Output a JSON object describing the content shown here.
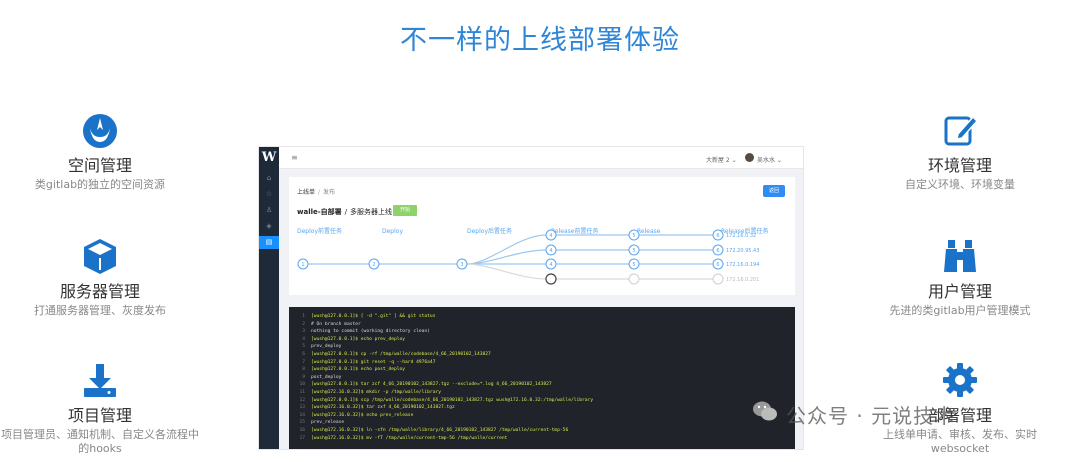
{
  "page": {
    "title": "不一样的上线部署体验"
  },
  "features_left": [
    {
      "title": "空间管理",
      "desc": "类gitlab的独立的空间资源",
      "icon": "rebel-alliance-icon"
    },
    {
      "title": "服务器管理",
      "desc": "打通服务器管理、灰度发布",
      "icon": "cube-icon"
    },
    {
      "title": "项目管理",
      "desc": "项目管理员、通知机制、自定义各流程中的hooks",
      "icon": "download-icon"
    }
  ],
  "features_right": [
    {
      "title": "环境管理",
      "desc": "自定义环境、环境变量",
      "icon": "edit-icon"
    },
    {
      "title": "用户管理",
      "desc": "先进的类gitlab用户管理模式",
      "icon": "binoculars-icon"
    },
    {
      "title": "部署管理",
      "desc": "上线单申请、审核、发布、实时websocket",
      "icon": "gear-icon"
    }
  ],
  "app": {
    "logo": "W",
    "menu_icon": "≡",
    "project_menu": "大新屋 2 ⌄",
    "user_name": "吴水水 ⌄",
    "sidebar": [
      "home-icon",
      "star-icon",
      "user-icon",
      "layers-icon",
      "deploy-icon"
    ],
    "breadcrumb": {
      "root": "上线单",
      "current": "发布"
    },
    "go_button": "返回",
    "card_title": {
      "left": "walle-自部署",
      "right": "多服务器上线"
    },
    "badge": "开始",
    "stages": [
      {
        "label": "Deploy前置任务",
        "num": "1"
      },
      {
        "label": "Deploy",
        "num": "2"
      },
      {
        "label": "Deploy后置任务",
        "num": "3"
      },
      {
        "label": "Release前置任务",
        "num": "4"
      },
      {
        "label": "Release",
        "num": "5"
      },
      {
        "label": "Release后置任务",
        "num": "6"
      }
    ],
    "servers": [
      "172.16.0.32",
      "172.20.95.43",
      "172.16.0.194",
      "172.16.0.201"
    ],
    "terminal": [
      {
        "n": "1",
        "t": "[wush@127.0.0.1]$ [ -d \".git\" ] && git status",
        "cmd": true
      },
      {
        "n": "2",
        "t": "# On branch master",
        "cmd": false
      },
      {
        "n": "3",
        "t": "nothing to commit (working directory clean)",
        "cmd": false
      },
      {
        "n": "4",
        "t": "[wush@127.0.0.1]$ echo prev_deploy",
        "cmd": true
      },
      {
        "n": "5",
        "t": "prev_deploy",
        "cmd": false
      },
      {
        "n": "6",
        "t": "[wush@127.0.0.1]$ cp -rf /tmp/walle/codebase/4_66_20190102_143827",
        "cmd": true
      },
      {
        "n": "7",
        "t": "[wush@127.0.0.1]$ git reset -q --hard 4976a47",
        "cmd": true
      },
      {
        "n": "8",
        "t": "[wush@127.0.0.1]$ echo post_deploy",
        "cmd": true
      },
      {
        "n": "9",
        "t": "post_deploy",
        "cmd": false
      },
      {
        "n": "10",
        "t": "[wush@127.0.0.1]$ tar zcf 4_66_20190102_143827.tgz --exclude=*.log 4_66_20190102_143827",
        "cmd": true
      },
      {
        "n": "11",
        "t": "[wush@172.16.0.32]$ mkdir -p /tmp/walle/library",
        "cmd": true
      },
      {
        "n": "12",
        "t": "[wush@127.0.0.1]$ scp /tmp/walle/codebase/4_66_20190102_143827.tgz wush@172.16.0.32:/tmp/walle/library",
        "cmd": true
      },
      {
        "n": "13",
        "t": "[wush@172.16.0.32]$ tar zxf 4_66_20190102_143827.tgz",
        "cmd": true
      },
      {
        "n": "14",
        "t": "[wush@172.16.0.32]$ echo prev_release",
        "cmd": true
      },
      {
        "n": "15",
        "t": "prev_release",
        "cmd": false
      },
      {
        "n": "16",
        "t": "[wush@172.16.0.32]$ ln -sfn /tmp/walle/library/4_66_20190102_143827 /tmp/walle/current-tmp-56",
        "cmd": true
      },
      {
        "n": "17",
        "t": "[wush@172.16.0.32]$ mv -fT /tmp/walle/current-tmp-56 /tmp/walle/current",
        "cmd": true
      }
    ]
  },
  "watermark": {
    "text": "公众号 · 元说技术"
  },
  "colors": {
    "accent": "#2f86d6",
    "title": "#2f86d6",
    "feature_icon": "#1a73c8"
  }
}
